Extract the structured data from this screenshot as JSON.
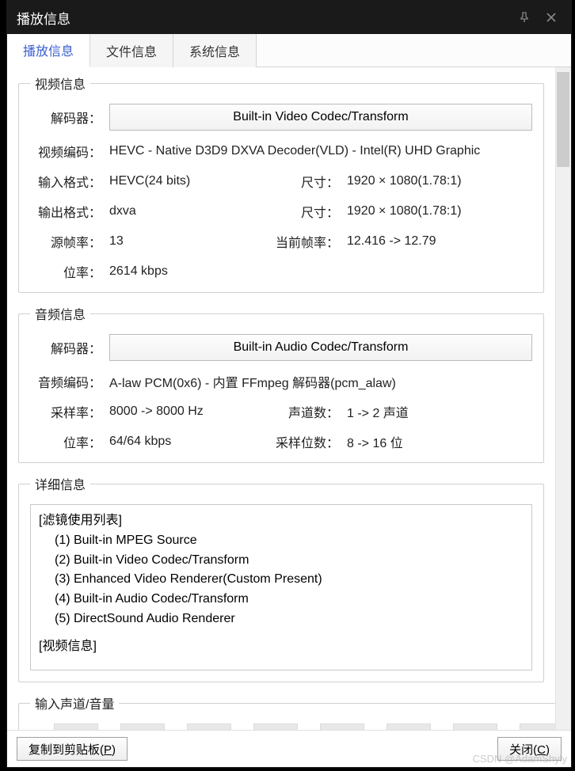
{
  "title": "播放信息",
  "tabs": {
    "playback": "播放信息",
    "file": "文件信息",
    "system": "系统信息"
  },
  "video": {
    "legend": "视频信息",
    "decoder_label": "解码器",
    "decoder_button": "Built-in Video Codec/Transform",
    "encoding_label": "视频编码",
    "encoding_value": "HEVC - Native D3D9 DXVA Decoder(VLD) - Intel(R) UHD Graphic",
    "input_format_label": "输入格式",
    "input_format_value": "HEVC(24 bits)",
    "input_size_label": "尺寸",
    "input_size_value": "1920 × 1080(1.78:1)",
    "output_format_label": "输出格式",
    "output_format_value": "dxva",
    "output_size_label": "尺寸",
    "output_size_value": "1920 × 1080(1.78:1)",
    "src_fps_label": "源帧率",
    "src_fps_value": "13",
    "cur_fps_label": "当前帧率",
    "cur_fps_value": "12.416 -> 12.79",
    "bitrate_label": "位率",
    "bitrate_value": "2614 kbps"
  },
  "audio": {
    "legend": "音频信息",
    "decoder_label": "解码器",
    "decoder_button": "Built-in Audio Codec/Transform",
    "encoding_label": "音频编码",
    "encoding_value": "A-law PCM(0x6) - 内置 FFmpeg 解码器(pcm_alaw)",
    "samplerate_label": "采样率",
    "samplerate_value": "8000 -> 8000 Hz",
    "channels_label": "声道数",
    "channels_value": "1 -> 2 声道",
    "bitrate_label": "位率",
    "bitrate_value": "64/64 kbps",
    "bitdepth_label": "采样位数",
    "bitdepth_value": "8 -> 16 位"
  },
  "detail": {
    "legend": "详细信息",
    "header": "[滤镜使用列表]",
    "items": [
      "(1) Built-in MPEG Source",
      "(2) Built-in Video Codec/Transform",
      "(3) Enhanced Video Renderer(Custom Present)",
      "(4) Built-in Audio Codec/Transform",
      "(5) DirectSound Audio Renderer"
    ],
    "trailer": "[视频信息]"
  },
  "volume": {
    "legend": "输入声道/音量"
  },
  "footer": {
    "copy_pre": "复制到剪贴板(",
    "copy_u": "P",
    "copy_post": ")",
    "close_pre": "关闭(",
    "close_u": "C",
    "close_post": ")"
  },
  "watermark": "CSDN @AdamShyly"
}
